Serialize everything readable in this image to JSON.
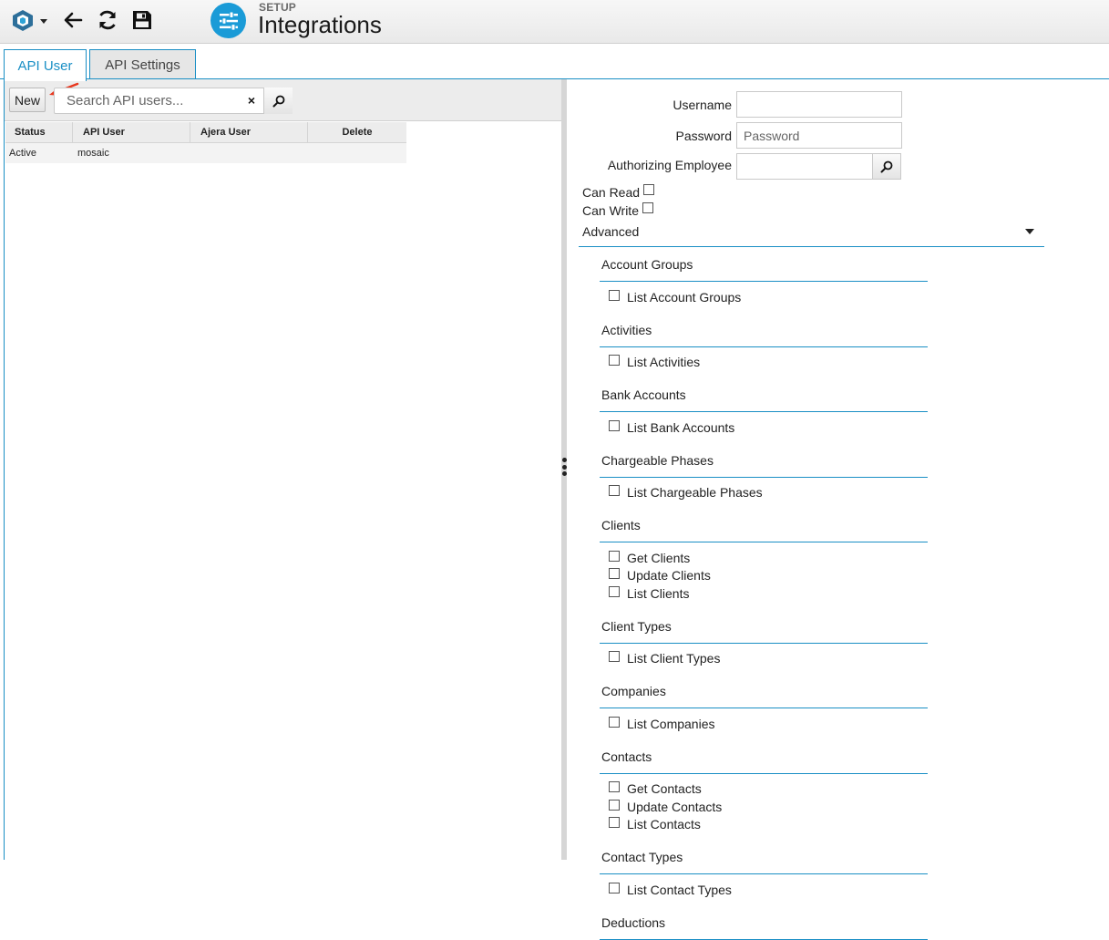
{
  "header": {
    "section": "SETUP",
    "title": "Integrations",
    "accent_color": "#1a9bd7",
    "icons": {
      "logo": "app-logo-icon",
      "back": "arrow-left-icon",
      "refresh": "refresh-icon",
      "save": "save-icon",
      "page": "sliders-icon"
    }
  },
  "tabs": [
    {
      "label": "API User",
      "active": true
    },
    {
      "label": "API Settings",
      "active": false
    }
  ],
  "left": {
    "new_label": "New",
    "search_placeholder": "Search API users...",
    "clear_label": "×",
    "columns": {
      "status": "Status",
      "api_user": "API User",
      "ajera_user": "Ajera User",
      "delete": "Delete"
    },
    "rows": [
      {
        "status": "Active",
        "api_user": "mosaic",
        "ajera_user": "",
        "delete": ""
      }
    ]
  },
  "form": {
    "username_label": "Username",
    "username_value": "",
    "password_label": "Password",
    "password_placeholder": "Password",
    "auth_employee_label": "Authorizing Employee",
    "auth_employee_value": "",
    "can_read_label": "Can Read",
    "can_write_label": "Can Write",
    "advanced_label": "Advanced",
    "groups": [
      {
        "title": "Account Groups",
        "items": [
          "List Account Groups"
        ]
      },
      {
        "title": "Activities",
        "items": [
          "List Activities"
        ]
      },
      {
        "title": "Bank Accounts",
        "items": [
          "List Bank Accounts"
        ]
      },
      {
        "title": "Chargeable Phases",
        "items": [
          "List Chargeable Phases"
        ]
      },
      {
        "title": "Clients",
        "items": [
          "Get Clients",
          "Update Clients",
          "List Clients"
        ]
      },
      {
        "title": "Client Types",
        "items": [
          "List Client Types"
        ]
      },
      {
        "title": "Companies",
        "items": [
          "List Companies"
        ]
      },
      {
        "title": "Contacts",
        "items": [
          "Get Contacts",
          "Update Contacts",
          "List Contacts"
        ]
      },
      {
        "title": "Contact Types",
        "items": [
          "List Contact Types"
        ]
      },
      {
        "title": "Deductions",
        "items": []
      }
    ]
  }
}
